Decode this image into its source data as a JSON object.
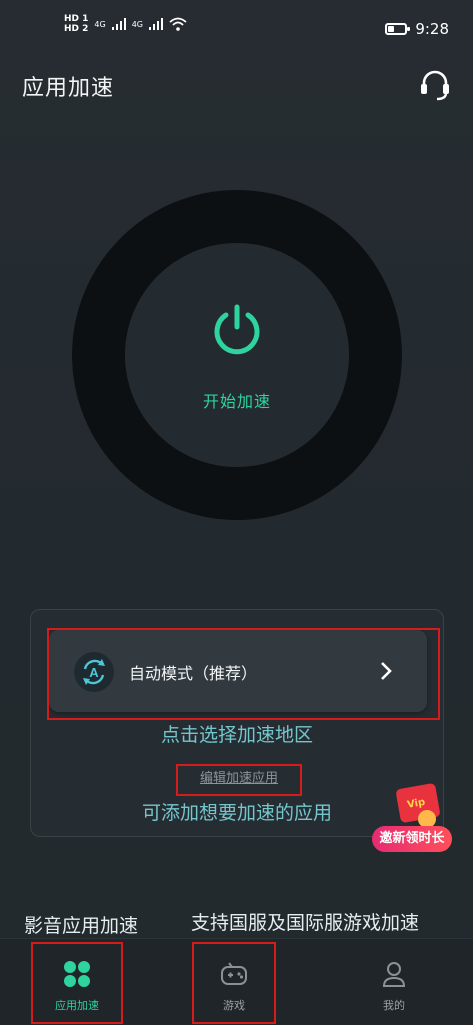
{
  "status_bar": {
    "sim1": "HD 1",
    "sim2": "HD 2",
    "net1": "4G",
    "net2": "4G",
    "battery_level": 0.35,
    "time": "9:28"
  },
  "header": {
    "title": "应用加速",
    "support_icon": "headset-icon"
  },
  "power": {
    "icon": "power-icon",
    "label": "开始加速"
  },
  "mode": {
    "icon": "auto-mode-icon",
    "label": "自动模式（推荐）",
    "region_hint": "点击选择加速地区",
    "edit_link": "编辑加速应用",
    "add_hint": "可添加想要加速的应用"
  },
  "promo": {
    "card_text": "Vip",
    "badge": "邀新领时长"
  },
  "features": {
    "left": "影音应用加速",
    "right": "支持国服及国际服游戏加速"
  },
  "nav": {
    "items": [
      {
        "label": "应用加速",
        "icon": "apps-grid-icon",
        "active": true
      },
      {
        "label": "游戏",
        "icon": "gamepad-icon",
        "active": false
      },
      {
        "label": "我的",
        "icon": "profile-icon",
        "active": false
      }
    ]
  },
  "colors": {
    "accent": "#2ed39e",
    "hint_text": "#74c6cd",
    "highlight_box": "#d61b1b",
    "background": "#252c31"
  }
}
